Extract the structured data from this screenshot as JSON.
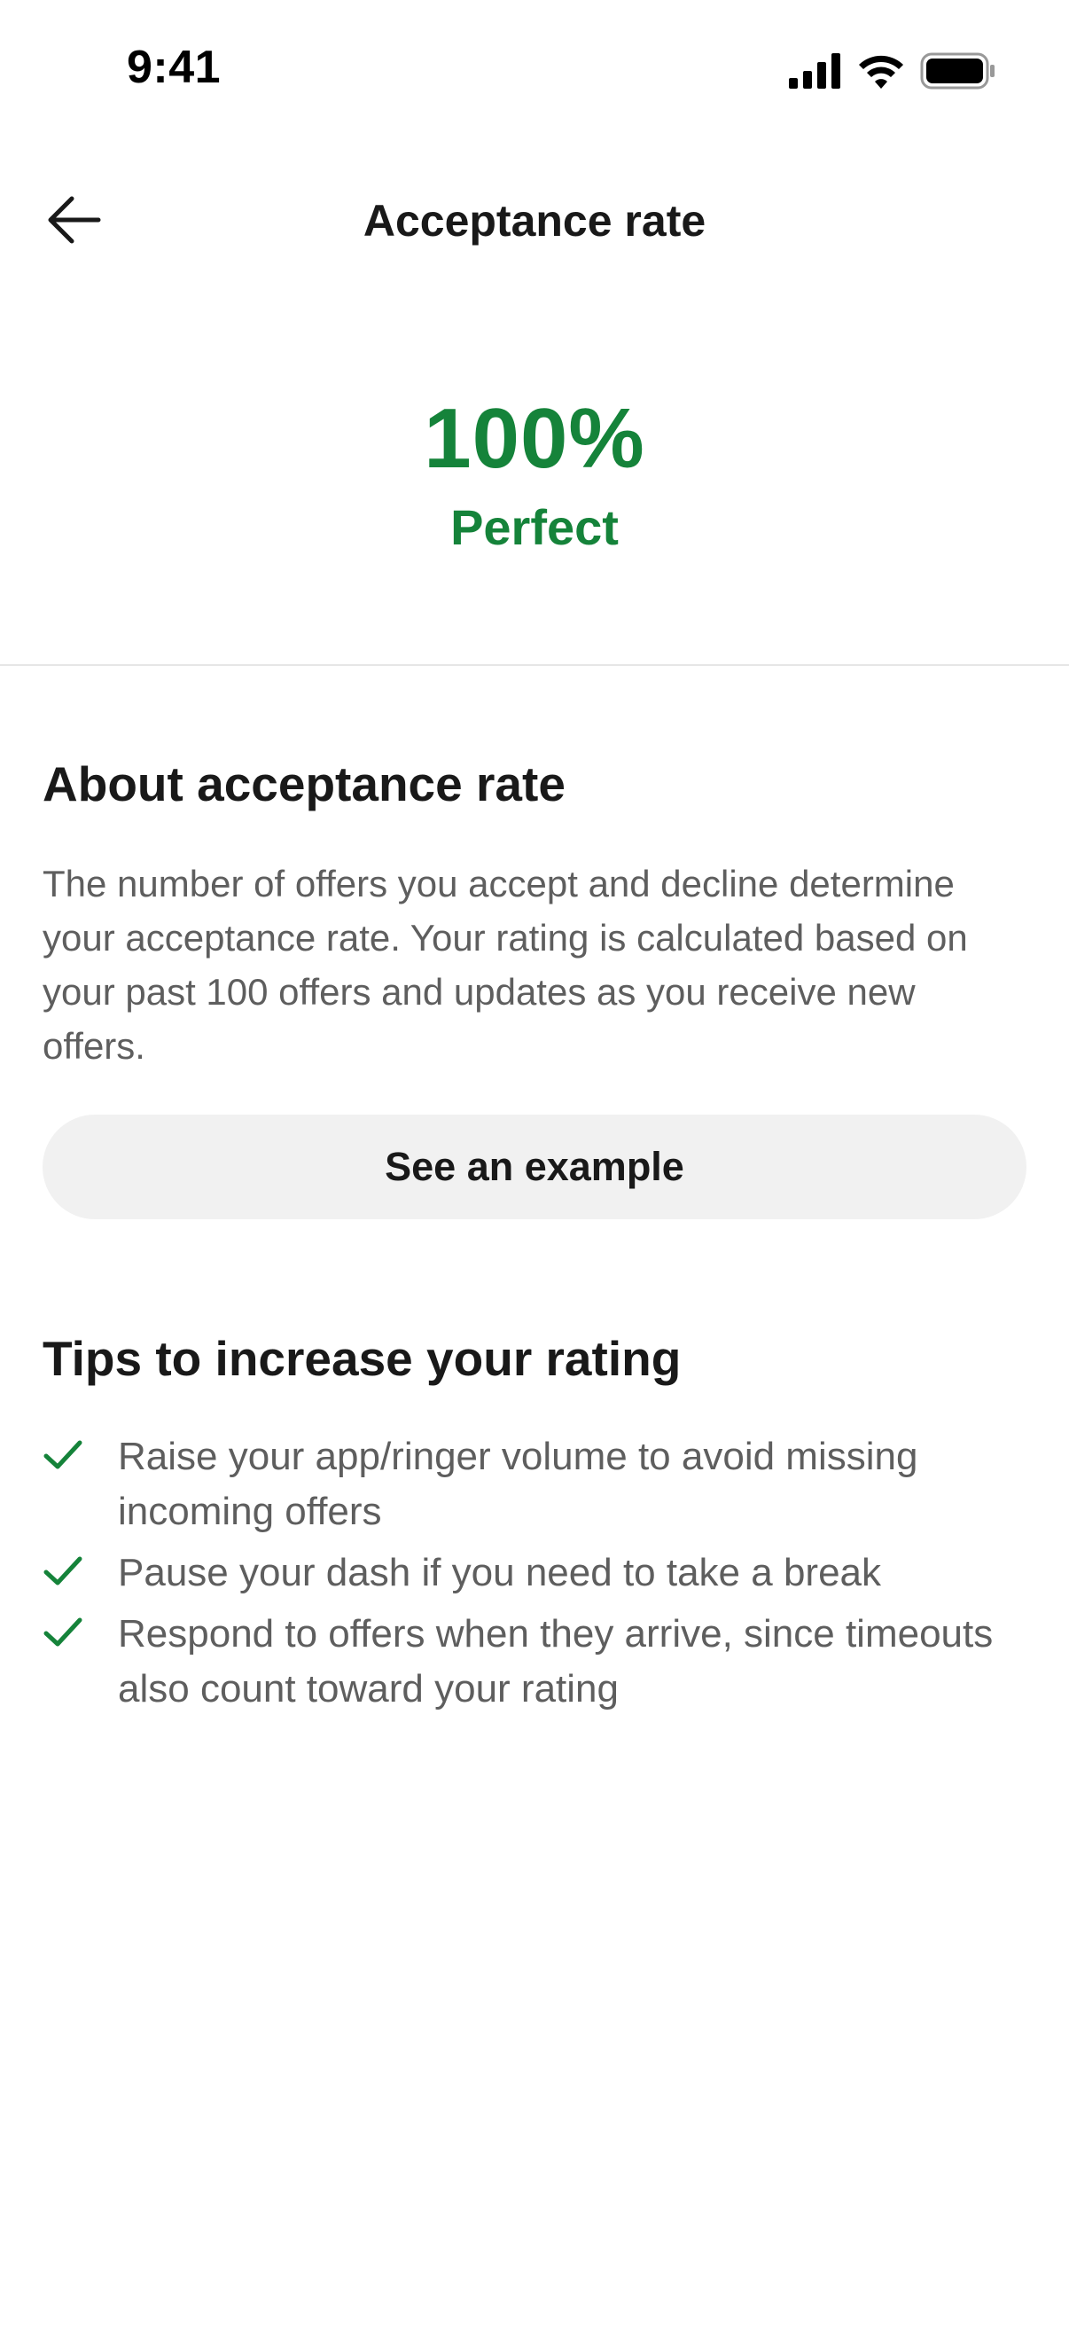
{
  "status_bar": {
    "time": "9:41",
    "icons": [
      "cellular-signal-icon",
      "wifi-icon",
      "battery-icon"
    ]
  },
  "nav": {
    "back_icon": "arrow-left-icon",
    "title": "Acceptance rate"
  },
  "rate": {
    "value": "100%",
    "label": "Perfect",
    "color": "#15833a"
  },
  "about": {
    "heading": "About acceptance rate",
    "body": "The number of offers you accept and decline determine your acceptance rate. Your rating is calculated based on your past 100 offers and updates as you receive new offers.",
    "example_button": "See an example"
  },
  "tips": {
    "heading": "Tips to increase your rating",
    "check_icon": "checkmark-icon",
    "check_color": "#15833a",
    "items": [
      "Raise your app/ringer volume to avoid missing incoming offers",
      "Pause your dash if you need to take a break",
      "Respond to offers when they arrive, since timeouts also count toward your rating"
    ]
  }
}
